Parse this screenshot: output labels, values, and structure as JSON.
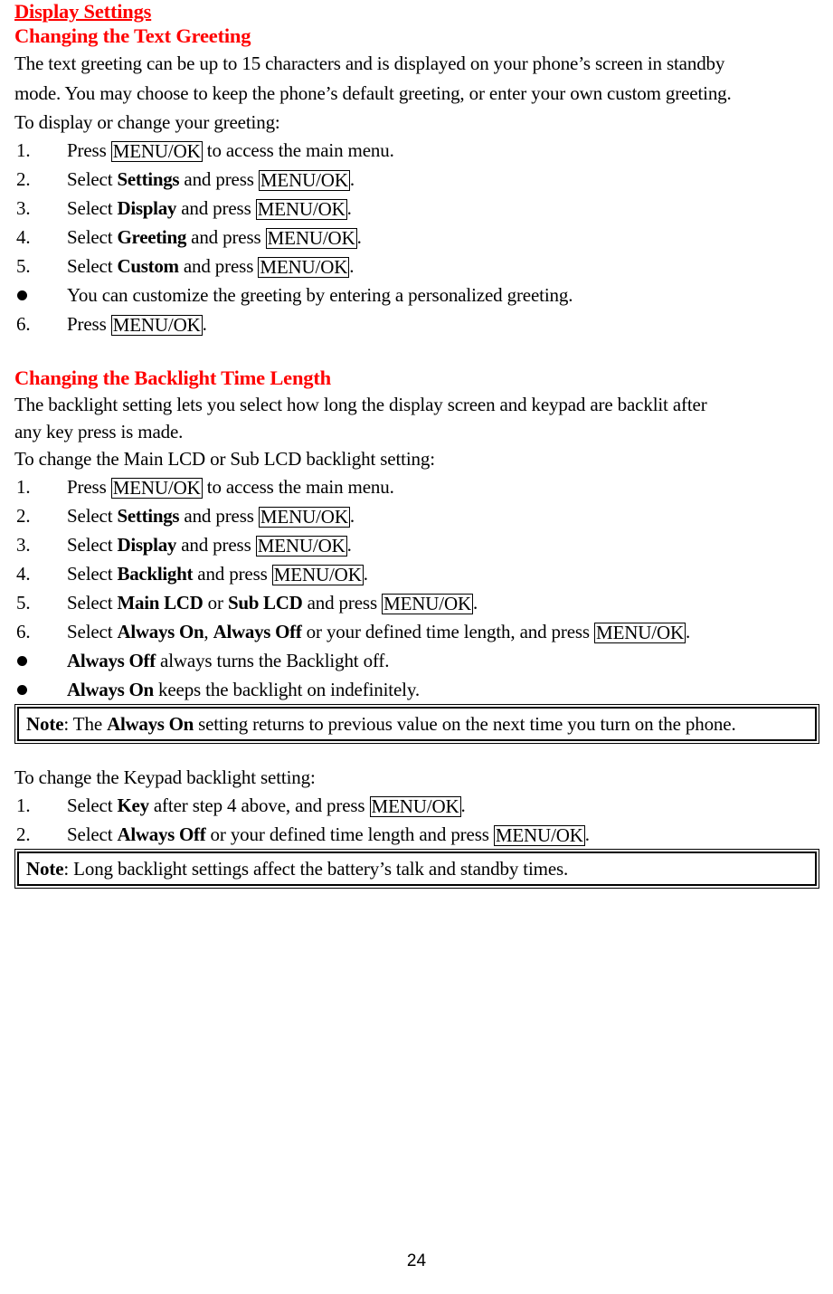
{
  "document": {
    "page_number": "24",
    "accent_color": "#ff0000",
    "sections": [
      {
        "id": "display-settings",
        "title": "Display Settings",
        "subtitle": "Changing the Text Greeting"
      },
      {
        "id": "backlight-time-length",
        "subtitle": "Changing the Backlight Time Length"
      }
    ]
  },
  "greeting_section": {
    "heading": "Display Settings",
    "subheading": "Changing the Text Greeting",
    "paragraph_line_1": "The text greeting can be up to 15 characters and is displayed on your phone’s screen in standby",
    "paragraph_line_2": "mode. You may choose to keep the phone’s default greeting, or enter your own custom greeting.",
    "paragraph_line_3": "To display or change your greeting:",
    "steps": [
      {
        "number": "1.",
        "pre": "Press ",
        "key": "MENU/OK",
        "post": " to access the main menu."
      },
      {
        "number": "2.",
        "pre": "Select ",
        "bold": "Settings",
        "mid": " and press ",
        "key": "MENU/OK",
        "post": "."
      },
      {
        "number": "3.",
        "pre": "Select ",
        "bold": "Display",
        "mid": " and press ",
        "key": "MENU/OK",
        "post": "."
      },
      {
        "number": "4.",
        "pre": "Select ",
        "bold": "Greeting",
        "mid": " and press ",
        "key": "MENU/OK",
        "post": "."
      },
      {
        "number": "5.",
        "pre": "Select ",
        "bold": "Custom",
        "mid": " and press ",
        "key": "MENU/OK",
        "post": "."
      }
    ],
    "bullet": " You can customize the greeting by entering a personalized greeting.",
    "final_step": {
      "number": "6.",
      "pre": "Press ",
      "key": "MENU/OK",
      "post": "."
    }
  },
  "backlight_section": {
    "subheading": "Changing the Backlight Time Length",
    "paragraph_line_1": "The backlight setting lets you select how long the display screen and keypad are backlit after",
    "paragraph_line_2": "any key press is made.",
    "paragraph_line_3": "To change the Main LCD or Sub LCD backlight setting:",
    "steps": [
      {
        "number": "1.",
        "pre": "Press ",
        "key": "MENU/OK",
        "post": " to access the main menu."
      },
      {
        "number": "2.",
        "pre": "Select ",
        "bold": "Settings",
        "mid": " and press ",
        "key": "MENU/OK",
        "post": "."
      },
      {
        "number": "3.",
        "pre": "Select ",
        "bold": "Display",
        "mid": " and press ",
        "key": "MENU/OK",
        "post": "."
      },
      {
        "number": "4.",
        "pre": "Select ",
        "bold": "Backlight",
        "mid": " and press ",
        "key": "MENU/OK",
        "post": "."
      },
      {
        "number": "5.",
        "pre": "Select ",
        "bold": "Main LCD",
        "mid": " or ",
        "bold2": "Sub LCD",
        "mid2": " and press ",
        "key": "MENU/OK",
        "post": "."
      },
      {
        "number": "6.",
        "pre": "Select ",
        "bold": "Always On",
        "mid": ", ",
        "bold2": "Always Off",
        "mid2": " or your defined time length, and press ",
        "key": "MENU/OK",
        "post": "."
      }
    ],
    "bullets": [
      {
        "bold": "Always Off",
        "text": " always turns the Backlight off."
      },
      {
        "bold": "Always On",
        "text": " keeps the backlight on indefinitely."
      }
    ],
    "note": {
      "label": "Note",
      "pre": ": The ",
      "bold": "Always On",
      "post": " setting returns to previous value on the next time you turn on the phone."
    }
  },
  "keypad_section": {
    "intro": "To change the Keypad backlight setting:",
    "steps": [
      {
        "number": "1.",
        "pre": "Select ",
        "bold": "Key",
        "mid": " after step 4 above, and press ",
        "key": "MENU/OK",
        "post": "."
      },
      {
        "number": "2.",
        "pre": "Select ",
        "bold": "Always Off",
        "mid": " or your defined time length and press ",
        "key": "MENU/OK",
        "post": "."
      }
    ],
    "note": {
      "label": "Note",
      "text": ": Long backlight settings affect the battery’s talk and standby times."
    }
  }
}
